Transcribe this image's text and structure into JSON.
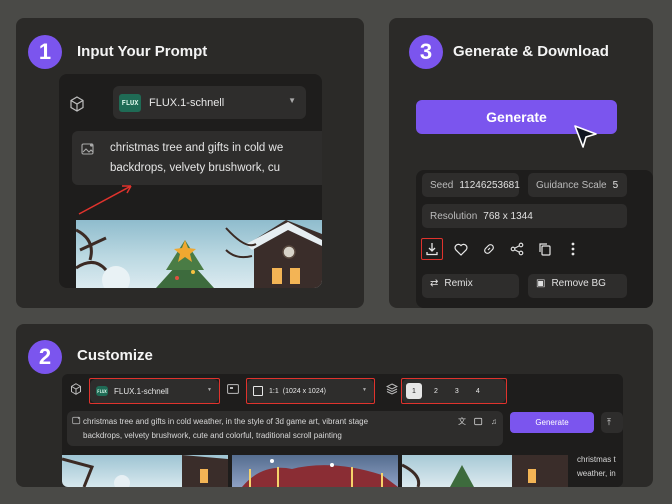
{
  "steps": {
    "one": {
      "number": "1",
      "title": "Input Your Prompt"
    },
    "two": {
      "number": "2",
      "title": "Customize"
    },
    "three": {
      "number": "3",
      "title": "Generate & Download"
    }
  },
  "model": {
    "logo": "FLUX",
    "name": "FLUX.1-schnell"
  },
  "prompt": {
    "short_line1": "christmas tree and gifts in cold we",
    "short_line2": "backdrops, velvety brushwork,  cu",
    "full_line1": "christmas tree and gifts in cold weather, in the style of 3d game art, vibrant stage",
    "full_line2": "backdrops, velvety brushwork,  cute and colorful, traditional scroll painting"
  },
  "generate_label": "Generate",
  "details": {
    "seed_label": "Seed",
    "seed_value": "11246253681",
    "guidance_label": "Guidance Scale",
    "guidance_value": "5",
    "resolution_label": "Resolution",
    "resolution_value": "768 x 1344"
  },
  "bottom_actions": {
    "remix": "Remix",
    "remove_bg": "Remove BG"
  },
  "customize": {
    "aspect": "1:1",
    "size": "(1024 x 1024)",
    "counts": [
      "1",
      "2",
      "3",
      "4"
    ],
    "side_text_1": "christmas t",
    "side_text_2": "weather, in"
  },
  "colors": {
    "accent": "#7b55ee",
    "highlight": "#e0332d",
    "card": "#2b2a28"
  }
}
